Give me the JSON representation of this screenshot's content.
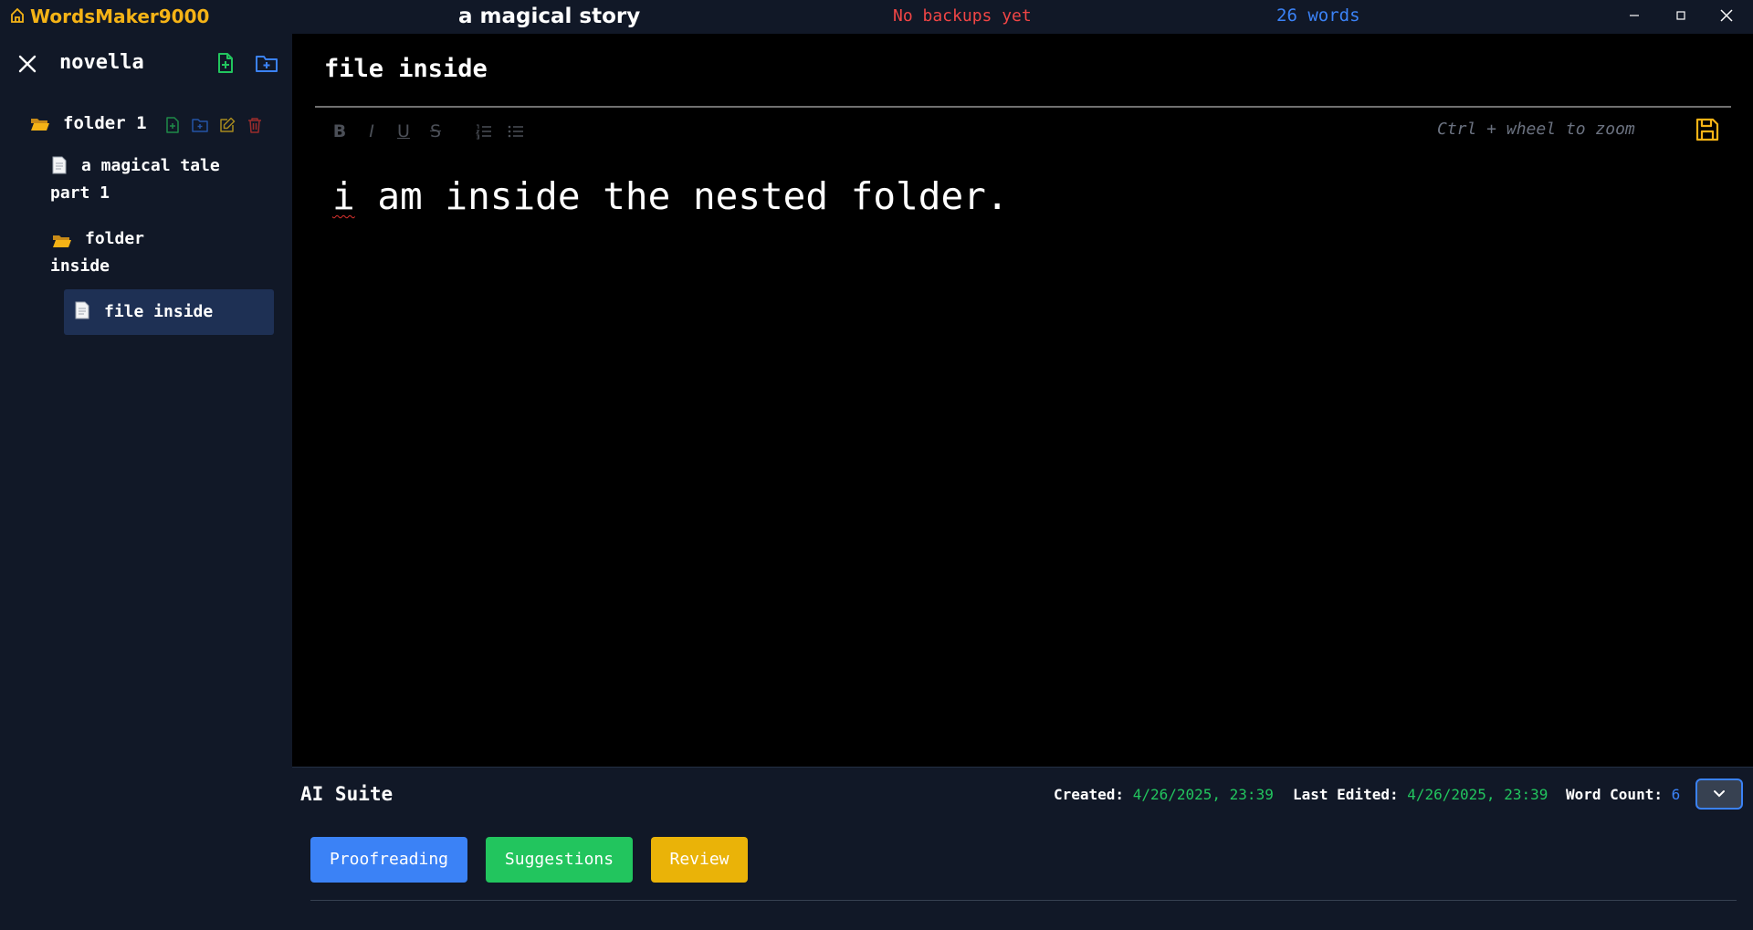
{
  "titlebar": {
    "app_name": "WordsMaker9000",
    "story_title": "a magical story",
    "backup_status": "No backups yet",
    "word_total": "26 words"
  },
  "sidebar": {
    "project_title": "novella",
    "tree": {
      "folder_1": "folder 1",
      "file_magic_line1": "a magical tale",
      "file_magic_line2": "part 1",
      "folder_inside_line1": "folder",
      "folder_inside_line2": "inside",
      "file_selected": "file inside"
    }
  },
  "editor": {
    "document_title": "file inside",
    "toolbar": {
      "bold": "B",
      "italic": "I",
      "underline": "U",
      "strike": "S"
    },
    "zoom_hint": "Ctrl + wheel to zoom",
    "content_first_word": "i",
    "content_rest": " am inside the nested folder."
  },
  "ai_suite": {
    "title": "AI Suite",
    "created_label": "Created:",
    "created_value": "4/26/2025, 23:39",
    "edited_label": "Last Edited:",
    "edited_value": "4/26/2025, 23:39",
    "count_label": "Word Count:",
    "count_value": "6",
    "buttons": {
      "proofreading": "Proofreading",
      "suggestions": "Suggestions",
      "review": "Review"
    }
  },
  "colors": {
    "accent_yellow": "#f5b316",
    "accent_blue": "#3b82f6",
    "accent_green": "#22c55e",
    "accent_red": "#f04545",
    "panel_bg": "#111827",
    "editor_bg": "#000000",
    "selected_bg": "#1e3054"
  },
  "icons": {
    "home": "home-icon",
    "close": "close-icon",
    "new_file": "file-plus-icon",
    "new_folder": "folder-plus-icon",
    "edit": "pencil-square-icon",
    "delete": "trash-icon",
    "save": "floppy-disk-icon",
    "collapse": "chevron-down-icon"
  }
}
